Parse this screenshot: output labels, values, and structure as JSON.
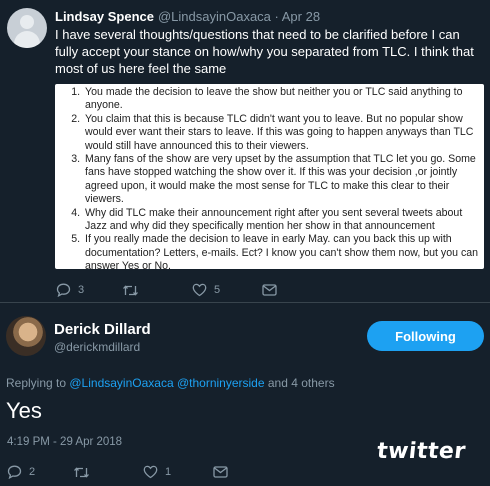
{
  "tweet1": {
    "author_name": "Lindsay Spence",
    "author_handle": "@LindsayinOaxaca · Apr 28",
    "text": "I have several thoughts/questions that need to be clarified before I can fully accept your stance on how/why you separated from TLC.  I think that most of us here feel the same",
    "list_items": [
      "You made the decision to leave the show but neither you or TLC said anything to anyone.",
      "You claim that this is because TLC didn't want  you to leave.  But no popular show would ever want their stars to leave.  If this was going to happen  anyways than TLC would still have announced this to their viewers.",
      "Many fans of the show are very upset by the assumption that TLC let you go.  Some fans have stopped watching the show over it. If this was your decision ,or jointly agreed upon,  it would make the most sense for TLC to make this clear to their viewers.",
      "Why did TLC make their announcement right after you sent several tweets about Jazz and why did they specifically mention her show in that announcement",
      "If you really made the decision to leave in early May. can you back this up with documentation?  Letters, e-mails. Ect?  I know you can't show them now, but you can answer Yes or No."
    ],
    "actions": {
      "reply_count": "3",
      "retweet_count": "",
      "like_count": "5"
    }
  },
  "tweet2": {
    "author_name": "Derick Dillard",
    "author_handle": "@derickmdillard",
    "follow_label": "Following",
    "reply_prefix": "Replying to ",
    "reply_mention_1": "@LindsayinOaxaca",
    "reply_mention_2": "@thorninyerside",
    "reply_suffix": " and 4 others",
    "text": "Yes",
    "timestamp": "4:19 PM - 29 Apr 2018",
    "actions": {
      "reply_count": "2",
      "retweet_count": "",
      "like_count": "1"
    }
  },
  "watermark": "twitter",
  "colors": {
    "background": "#15202b",
    "accent": "#1da1f2",
    "muted": "#8899a6"
  }
}
